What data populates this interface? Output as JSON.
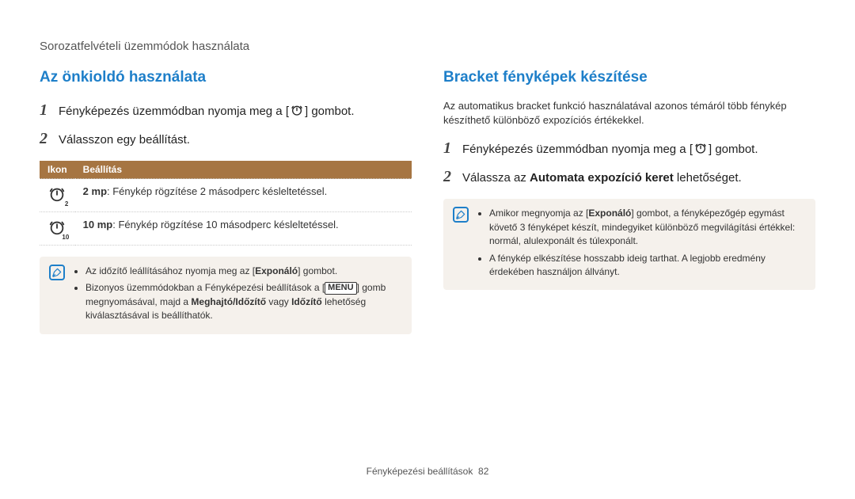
{
  "header": {
    "breadcrumb": "Sorozatfelvételi üzemmódok használata"
  },
  "left": {
    "title": "Az önkioldó használata",
    "steps": {
      "s1_num": "1",
      "s1_pre": "Fényképezés üzemmódban nyomja meg a [",
      "s1_post": "] gombot.",
      "s1_icon": "timer-icon",
      "s2_num": "2",
      "s2_text": "Válasszon egy beállítást."
    },
    "table": {
      "head_icon": "Ikon",
      "head_setting": "Beállítás",
      "r1_icon": "timer-2-icon",
      "r1_bold": "2 mp",
      "r1_text": ": Fénykép rögzítése 2 másodperc késleltetéssel.",
      "r2_icon": "timer-10-icon",
      "r2_bold": "10 mp",
      "r2_text": ": Fénykép rögzítése 10 másodperc késleltetéssel."
    },
    "note": {
      "icon": "info-icon",
      "i1_pre": "Az időzítő leállításához nyomja meg az [",
      "i1_bold": "Exponáló",
      "i1_post": "] gombot.",
      "i2_pre": "Bizonyos üzemmódokban a Fényképezési beállítások a [",
      "i2_menu": "MENU",
      "i2_mid": "] gomb megnyomásával, majd a ",
      "i2_bold1": "Meghajtó/Időzítő",
      "i2_or": " vagy ",
      "i2_bold2": "Időzítő",
      "i2_post": " lehetőség kiválasztásával is beállíthatók."
    }
  },
  "right": {
    "title": "Bracket fényképek készítése",
    "intro": "Az automatikus bracket funkció használatával azonos témáról több fénykép készíthető különböző expozíciós értékekkel.",
    "steps": {
      "s1_num": "1",
      "s1_pre": "Fényképezés üzemmódban nyomja meg a [",
      "s1_post": "] gombot.",
      "s1_icon": "timer-icon",
      "s2_num": "2",
      "s2_pre": "Válassza az ",
      "s2_bold": "Automata expozíció keret",
      "s2_post": " lehetőséget."
    },
    "note": {
      "icon": "info-icon",
      "i1_pre": "Amikor megnyomja az [",
      "i1_bold": "Exponáló",
      "i1_post": "] gombot, a fényképezőgép egymást követő 3 fényképet készít, mindegyiket különböző megvilágítási értékkel: normál, alulexponált és túlexponált.",
      "i2_text": "A fénykép elkészítése hosszabb ideig tarthat. A legjobb eredmény érdekében használjon állványt."
    }
  },
  "footer": {
    "section": "Fényképezési beállítások",
    "page": "82"
  }
}
